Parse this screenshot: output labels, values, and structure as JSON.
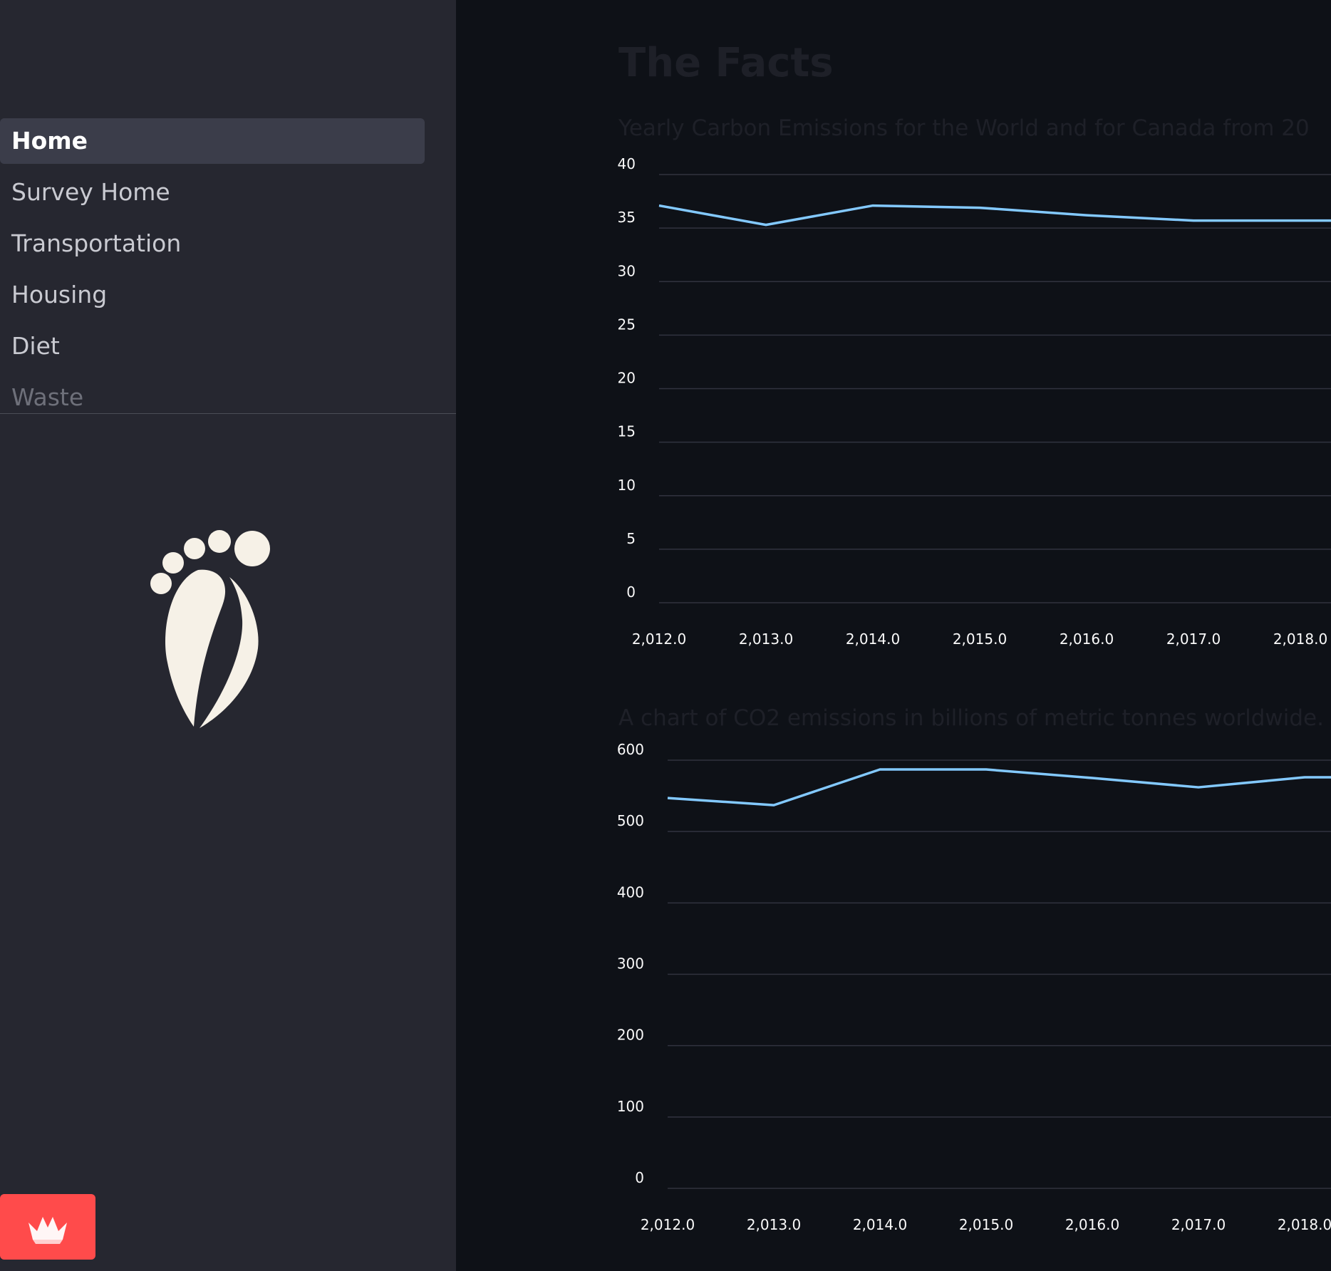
{
  "sidebar": {
    "items": [
      {
        "label": "Home",
        "active": true
      },
      {
        "label": "Survey Home"
      },
      {
        "label": "Transportation"
      },
      {
        "label": "Housing"
      },
      {
        "label": "Diet"
      },
      {
        "label": "Waste"
      }
    ],
    "logo_icon": "footprint-leaf-icon",
    "deploy_icon": "streamlit-crown-icon"
  },
  "main": {
    "title": "The Facts",
    "caption1": "Yearly Carbon Emissions for the World and for Canada from 20",
    "caption2": "A chart of CO2 emissions in billions of metric tonnes worldwide."
  },
  "colors": {
    "line": "#83c9ff",
    "sidebar_bg": "#262730",
    "main_bg": "#0e1117",
    "accent": "#ff4b4b"
  },
  "chart_data": [
    {
      "type": "line",
      "x_tick_labels": [
        "2,012.0",
        "2,013.0",
        "2,014.0",
        "2,015.0",
        "2,016.0",
        "2,017.0",
        "2,018.0"
      ],
      "y_tick_labels": [
        "0",
        "5",
        "10",
        "15",
        "20",
        "25",
        "30",
        "35",
        "40"
      ],
      "x": [
        2012,
        2013,
        2014,
        2015,
        2016,
        2017,
        2018
      ],
      "values": [
        37.1,
        35.3,
        37.1,
        36.9,
        36.2,
        35.7,
        35.7
      ],
      "ylim": [
        0,
        40
      ],
      "grid": true
    },
    {
      "type": "line",
      "x_tick_labels": [
        "2,012.0",
        "2,013.0",
        "2,014.0",
        "2,015.0",
        "2,016.0",
        "2,017.0",
        "2,018.0"
      ],
      "y_tick_labels": [
        "0",
        "100",
        "200",
        "300",
        "400",
        "500",
        "600"
      ],
      "x": [
        2012,
        2013,
        2014,
        2015,
        2016,
        2017,
        2018
      ],
      "values": [
        547,
        537,
        587,
        587,
        575,
        562,
        576
      ],
      "ylim": [
        0,
        600
      ],
      "grid": true
    }
  ]
}
